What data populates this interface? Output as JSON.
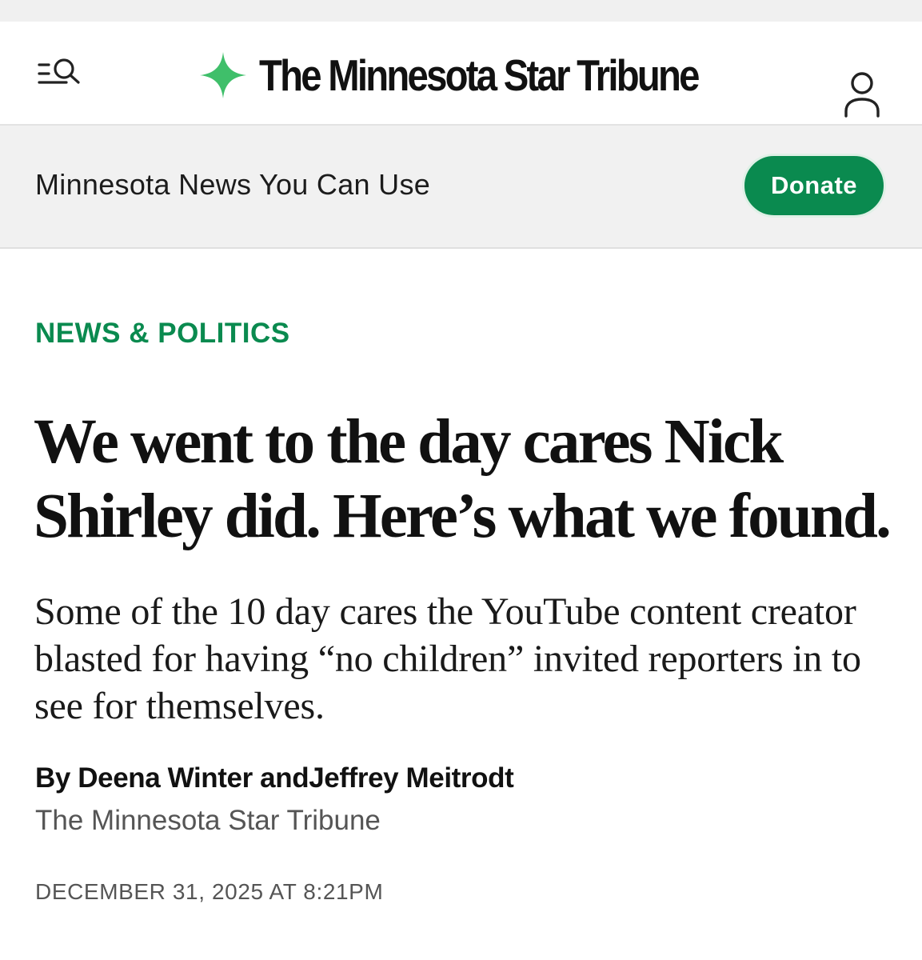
{
  "masthead": {
    "logo_text": "The Minnesota Star Tribune",
    "menu_icon": "menu-search-icon",
    "account_icon": "user-icon",
    "brand_color": "#0a8a4f",
    "star_color": "#3fbf6a"
  },
  "promo": {
    "text": "Minnesota News You Can Use",
    "donate_label": "Donate"
  },
  "article": {
    "category": "NEWS & POLITICS",
    "headline": "We went to the day cares Nick Shirley did. Here’s what we found.",
    "dek": "Some of the 10 day cares the YouTube content creator blasted for having “no children” invited reporters in to see for themselves.",
    "byline": {
      "prefix": "By",
      "author1": "Deena Winter",
      "joiner": "and",
      "author2": "Jeffrey Meitrodt"
    },
    "publication": "The Minnesota Star Tribune",
    "date": "DECEMBER 31, 2025 AT 8:21PM"
  }
}
